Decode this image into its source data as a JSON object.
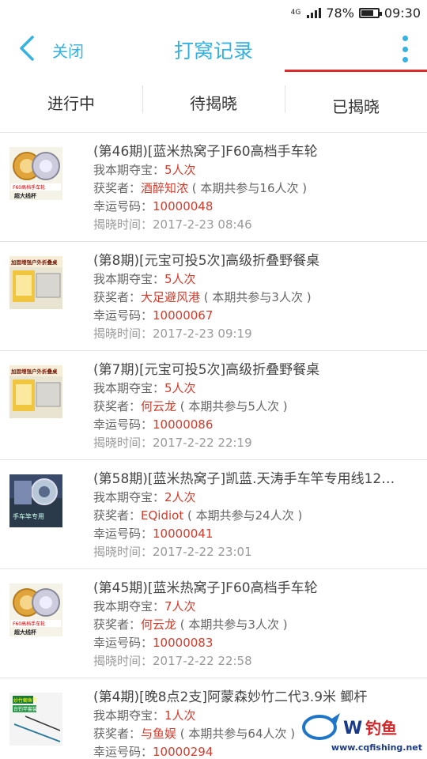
{
  "status": {
    "network": "4G",
    "battery": "78%",
    "battery_level": 0.78,
    "time": "09:30"
  },
  "nav": {
    "close_label": "关闭",
    "title": "打窝记录"
  },
  "tabs": [
    "进行中",
    "待揭晓",
    "已揭晓"
  ],
  "active_tab": 2,
  "colors": {
    "accent": "#34b2e2",
    "indicator": "#e02a2a",
    "highlight": "#d63b2c"
  },
  "labels": {
    "my_bet": "我本期夺宝：",
    "winner": "获奖者：",
    "lucky_code": "幸运号码：",
    "reveal_time": "揭晓时间："
  },
  "records": [
    {
      "title": "(第46期)[蓝米热窝子]F60高档手车轮",
      "my_count": "5人次",
      "winner": "酒醉知浓",
      "participants": "( 本期共参与16人次 )",
      "lucky_code": "10000048",
      "time": "2017-2-23 08:46",
      "thumb": "reel"
    },
    {
      "title": "(第8期)[元宝可投5次]高级折叠野餐桌",
      "my_count": "5人次",
      "winner": "大足避风港",
      "participants": "( 本期共参与3人次 )",
      "lucky_code": "10000067",
      "time": "2017-2-23 09:19",
      "thumb": "table"
    },
    {
      "title": "(第7期)[元宝可投5次]高级折叠野餐桌",
      "my_count": "5人次",
      "winner": "何云龙",
      "participants": "( 本期共参与5人次 )",
      "lucky_code": "10000086",
      "time": "2017-2-22 22:19",
      "thumb": "table"
    },
    {
      "title": "(第58期)[蓝米热窝子]凯蓝.天涛手车竿专用线12…",
      "my_count": "2人次",
      "winner": "EQidiot",
      "participants": "( 本期共参与24人次 )",
      "lucky_code": "10000041",
      "time": "2017-2-22 23:01",
      "thumb": "line"
    },
    {
      "title": "(第45期)[蓝米热窝子]F60高档手车轮",
      "my_count": "7人次",
      "winner": "何云龙",
      "participants": "( 本期共参与3人次 )",
      "lucky_code": "10000083",
      "time": "2017-2-22 22:58",
      "thumb": "reel"
    },
    {
      "title": "(第4期)[晚8点2支]阿蒙森妙竹二代3.9米 鲫杆",
      "my_count": "1人次",
      "winner": "与鱼娱",
      "participants": "( 本期共参与64人次 )",
      "lucky_code": "10000294",
      "time": "",
      "thumb": "rod"
    }
  ],
  "thumb_text": {
    "reel_top": "F60高档手车轮",
    "reel_bottom": "超大线杯",
    "table_top": "加固增强户外折叠桌",
    "line_text": "手车竿专用",
    "rod_top": "妙竹鲫鱼竿",
    "rod_bottom": "台钓竿套装"
  },
  "watermark": {
    "brand": "钓鱼",
    "site": "www.cqfishing.net"
  }
}
